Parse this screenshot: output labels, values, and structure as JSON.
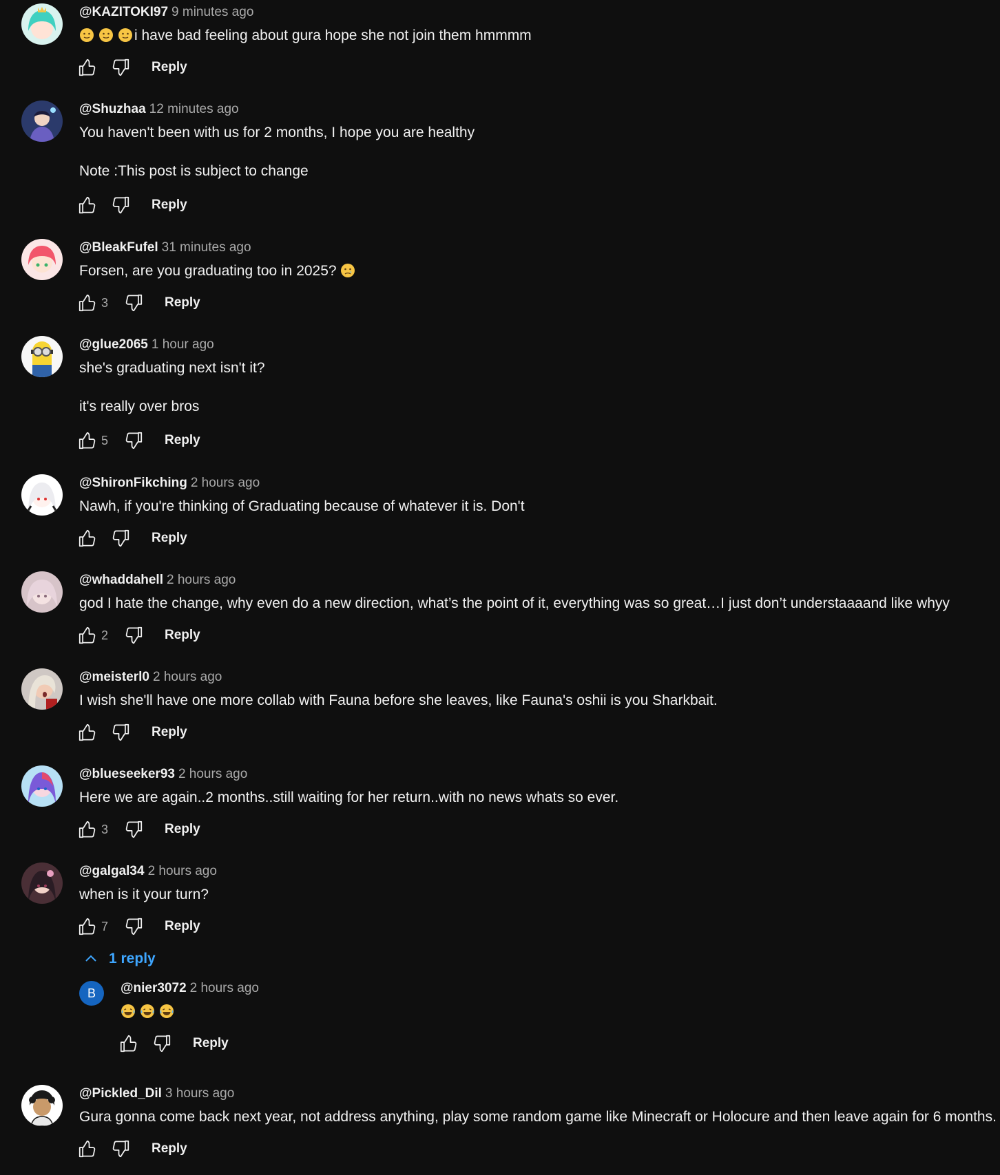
{
  "reply_label": "Reply",
  "comments": [
    {
      "author": "@KAZITOKI97",
      "time": "9 minutes ago",
      "text": "i have bad feeling about gura hope she not join them hmmmm",
      "likes": ""
    },
    {
      "author": "@Shuzhaa",
      "time": "12 minutes ago",
      "text": "You haven't been with us for 2 months, I hope you are healthy\n\nNote :This post is subject to change",
      "likes": ""
    },
    {
      "author": "@BleakFufel",
      "time": "31 minutes ago",
      "text": "Forsen, are you graduating too in 2025?",
      "likes": "3"
    },
    {
      "author": "@glue2065",
      "time": "1 hour ago",
      "text": "she's graduating next isn't it?\n\nit's really over bros",
      "likes": "5"
    },
    {
      "author": "@ShironFikching",
      "time": "2 hours ago",
      "text": "Nawh, if you're thinking of Graduating because of whatever it is. Don't",
      "likes": ""
    },
    {
      "author": "@whaddahell",
      "time": "2 hours ago",
      "text": "god I hate the change, why even do a new direction, what’s the point of it, everything was so great…I just don’t understaaaand like whyy",
      "likes": "2"
    },
    {
      "author": "@meisterl0",
      "time": "2 hours ago",
      "text": "I wish she'll have one more collab with Fauna before she leaves, like Fauna's oshii is you Sharkbait.",
      "likes": ""
    },
    {
      "author": "@blueseeker93",
      "time": "2 hours ago",
      "text": "Here we are again..2 months..still waiting for her return..with no news whats so ever.",
      "likes": "3"
    },
    {
      "author": "@galgal34",
      "time": "2 hours ago",
      "text": "when is it your turn?",
      "likes": "7"
    },
    {
      "author": "@Pickled_Dil",
      "time": "3 hours ago",
      "text": "Gura gonna come back next year, not address anything, play some random game like Minecraft or Holocure and then leave again for 6 months.",
      "likes": ""
    }
  ],
  "replies_toggle": "1 reply",
  "reply": {
    "avatar_letter": "B",
    "author": "@nier3072",
    "time": "2 hours ago"
  },
  "colors": {
    "background": "#0f0f0f",
    "text": "#f1f1f1",
    "secondary": "#aaaaaa",
    "link": "#3ea6ff",
    "avatar_b": "#1565c0"
  },
  "icons": {
    "like": "thumb-up-outline-icon",
    "dislike": "thumb-down-outline-icon",
    "expand": "chevron-up-icon",
    "emoji_slight": "slightly-smiling-face-emoji",
    "emoji_sad": "sad-face-emoji",
    "emoji_laugh": "tears-of-joy-emoji"
  }
}
